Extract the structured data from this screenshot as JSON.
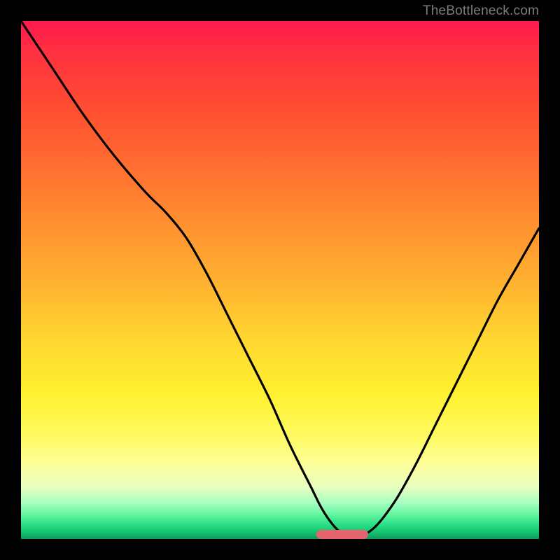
{
  "watermark": "TheBottleneck.com",
  "chart_data": {
    "type": "line",
    "title": "",
    "xlabel": "",
    "ylabel": "",
    "xlim": [
      0,
      100
    ],
    "ylim": [
      0,
      100
    ],
    "legend": false,
    "grid": false,
    "background_gradient": {
      "top_color": "#ff1a4d",
      "mid_color": "#ffe030",
      "bottom_color": "#0e9a60"
    },
    "series": [
      {
        "name": "bottleneck-curve",
        "color": "#000000",
        "x": [
          0,
          6,
          12,
          18,
          24,
          28,
          32,
          36,
          40,
          44,
          48,
          52,
          56,
          58,
          60,
          62,
          64,
          68,
          72,
          76,
          80,
          84,
          88,
          92,
          96,
          100
        ],
        "values": [
          100,
          91,
          82,
          74,
          67,
          63,
          58,
          51,
          43,
          35,
          27,
          18,
          10,
          6,
          3,
          1,
          0,
          2,
          7,
          14,
          22,
          30,
          38,
          46,
          53,
          60
        ]
      }
    ],
    "optimal_marker": {
      "x_start": 57,
      "x_end": 67,
      "color": "#e4656d"
    }
  }
}
